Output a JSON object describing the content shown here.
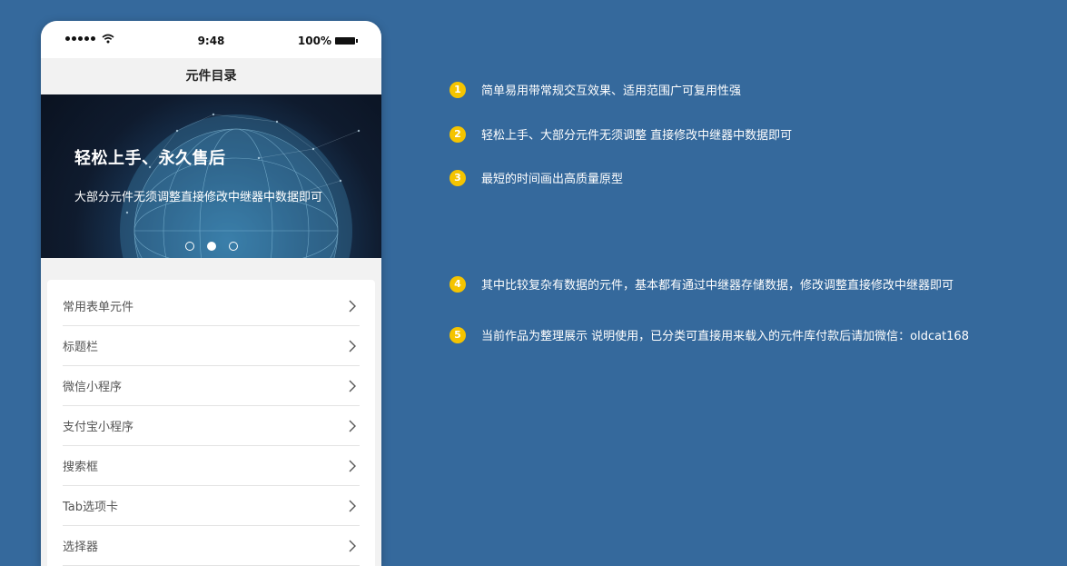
{
  "status": {
    "time": "9:48",
    "battery": "100%"
  },
  "nav": {
    "title": "元件目录"
  },
  "banner": {
    "title": "轻松上手、永久售后",
    "subtitle": "大部分元件无须调整直接修改中继器中数据即可",
    "pages": 3,
    "active_page": 2
  },
  "menu": [
    {
      "label": "常用表单元件"
    },
    {
      "label": "标题栏"
    },
    {
      "label": "微信小程序"
    },
    {
      "label": "支付宝小程序"
    },
    {
      "label": "搜索框"
    },
    {
      "label": "Tab选项卡"
    },
    {
      "label": "选择器"
    }
  ],
  "features": [
    {
      "num": "1",
      "text": "简单易用带常规交互效果、适用范围广可复用性强"
    },
    {
      "num": "2",
      "text": "轻松上手、大部分元件无须调整 直接修改中继器中数据即可"
    },
    {
      "num": "3",
      "text": "最短的时间画出高质量原型"
    },
    {
      "num": "4",
      "text": "其中比较复杂有数据的元件，基本都有通过中继器存储数据，修改调整直接修改中继器即可"
    },
    {
      "num": "5",
      "text": "当前作品为整理展示 说明使用，已分类可直接用来载入的元件库付款后请加微信：oldcat168"
    }
  ],
  "colors": {
    "background": "#35699c",
    "accent": "#f5c400"
  }
}
